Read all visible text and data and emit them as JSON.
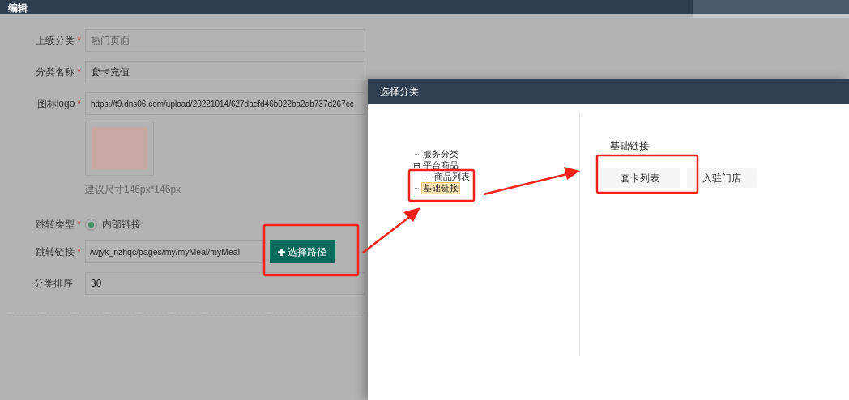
{
  "page": {
    "title": "编辑"
  },
  "form": {
    "fields": [
      {
        "kind": "text",
        "label": "上级分类",
        "required_mark": "*",
        "placeholder": "热门页面"
      },
      {
        "kind": "text",
        "label": "分类名称",
        "required_mark": "*",
        "value": "套卡充值"
      },
      {
        "kind": "text",
        "label": "图标logo",
        "required_mark": "*",
        "value": "https://t9.dns06.com/upload/20221014/627daefd46b022ba2ab737d267cc"
      },
      {
        "kind": "image",
        "hint": "建议尺寸146px*146px"
      },
      {
        "kind": "radio",
        "label": "跳转类型",
        "required_mark": "*",
        "options": [
          {
            "label": "内部链接",
            "selected": true
          }
        ]
      },
      {
        "kind": "link",
        "label": "跳转链接",
        "required_mark": "*",
        "value": "/wjyk_nzhqc/pages/my/myMeal/myMeal",
        "button": "选择路径"
      },
      {
        "kind": "text",
        "label": "分类排序",
        "value": "30"
      }
    ]
  },
  "dialog": {
    "title": "选择分类",
    "tree": [
      {
        "label": "服务分类",
        "selected": false
      },
      {
        "label": "平台商品",
        "selected": false,
        "expanded": true,
        "children": [
          {
            "label": "商品列表",
            "selected": false
          }
        ]
      },
      {
        "label": "基础链接",
        "selected": true
      }
    ],
    "section_title": "基础链接",
    "links": [
      "套卡列表",
      "入驻门店"
    ]
  }
}
